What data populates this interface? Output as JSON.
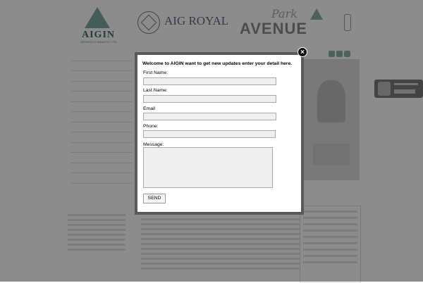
{
  "header": {
    "logo_aigin": "AIGIN",
    "logo_aigin_sub": "INFRATECH INDIA PVT LTD",
    "logo_royal": "AIG ROYAL",
    "logo_avenue_script": "Park",
    "logo_avenue": "AVENUE"
  },
  "popup": {
    "heading": "Welcome to AIGIN want to get new updates enter your detail here.",
    "close_label": "×",
    "fields": [
      {
        "label": "First Name:",
        "value": ""
      },
      {
        "label": "Last Name:",
        "value": ""
      },
      {
        "label": "Email",
        "value": ""
      },
      {
        "label": "Phone:",
        "value": ""
      }
    ],
    "message_label": "Message:",
    "message_value": "",
    "send_label": "SEND"
  },
  "colors": {
    "overlay": "#000000",
    "modal_border": "#5a5a5a",
    "field_bg": "#efefef"
  }
}
